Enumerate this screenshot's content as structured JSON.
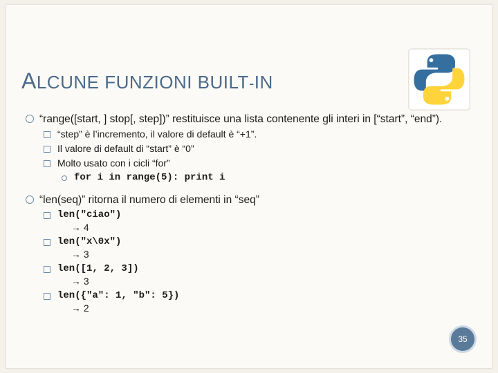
{
  "title_html": "<span class='lead'>A</span>LCUNE FUNZIONI BUILT<span style='font-size:22px'>-</span>IN",
  "logo_alt": "python-logo",
  "range": {
    "desc": "“range([start, ] stop[, step])” restituisce una lista contenente gli interi in [“start”, “end”).",
    "subs": [
      "“step” è l’incremento, il valore di default è “+1”.",
      "Il valore di default di “start” è “0”",
      "Molto usato con i cicli “for”"
    ],
    "code": "for i in range(5): print i"
  },
  "len": {
    "desc": "“len(seq)” ritorna il numero di elementi in “seq”",
    "examples": [
      {
        "code": "len(\"ciao\")",
        "result": "→ 4"
      },
      {
        "code": "len(\"x\\0x\")",
        "result": "→ 3"
      },
      {
        "code": "len([1, 2, 3])",
        "result": "→ 3"
      },
      {
        "code": "len({\"a\": 1, \"b\": 5})",
        "result": "→ 2"
      }
    ]
  },
  "page_number": "35"
}
